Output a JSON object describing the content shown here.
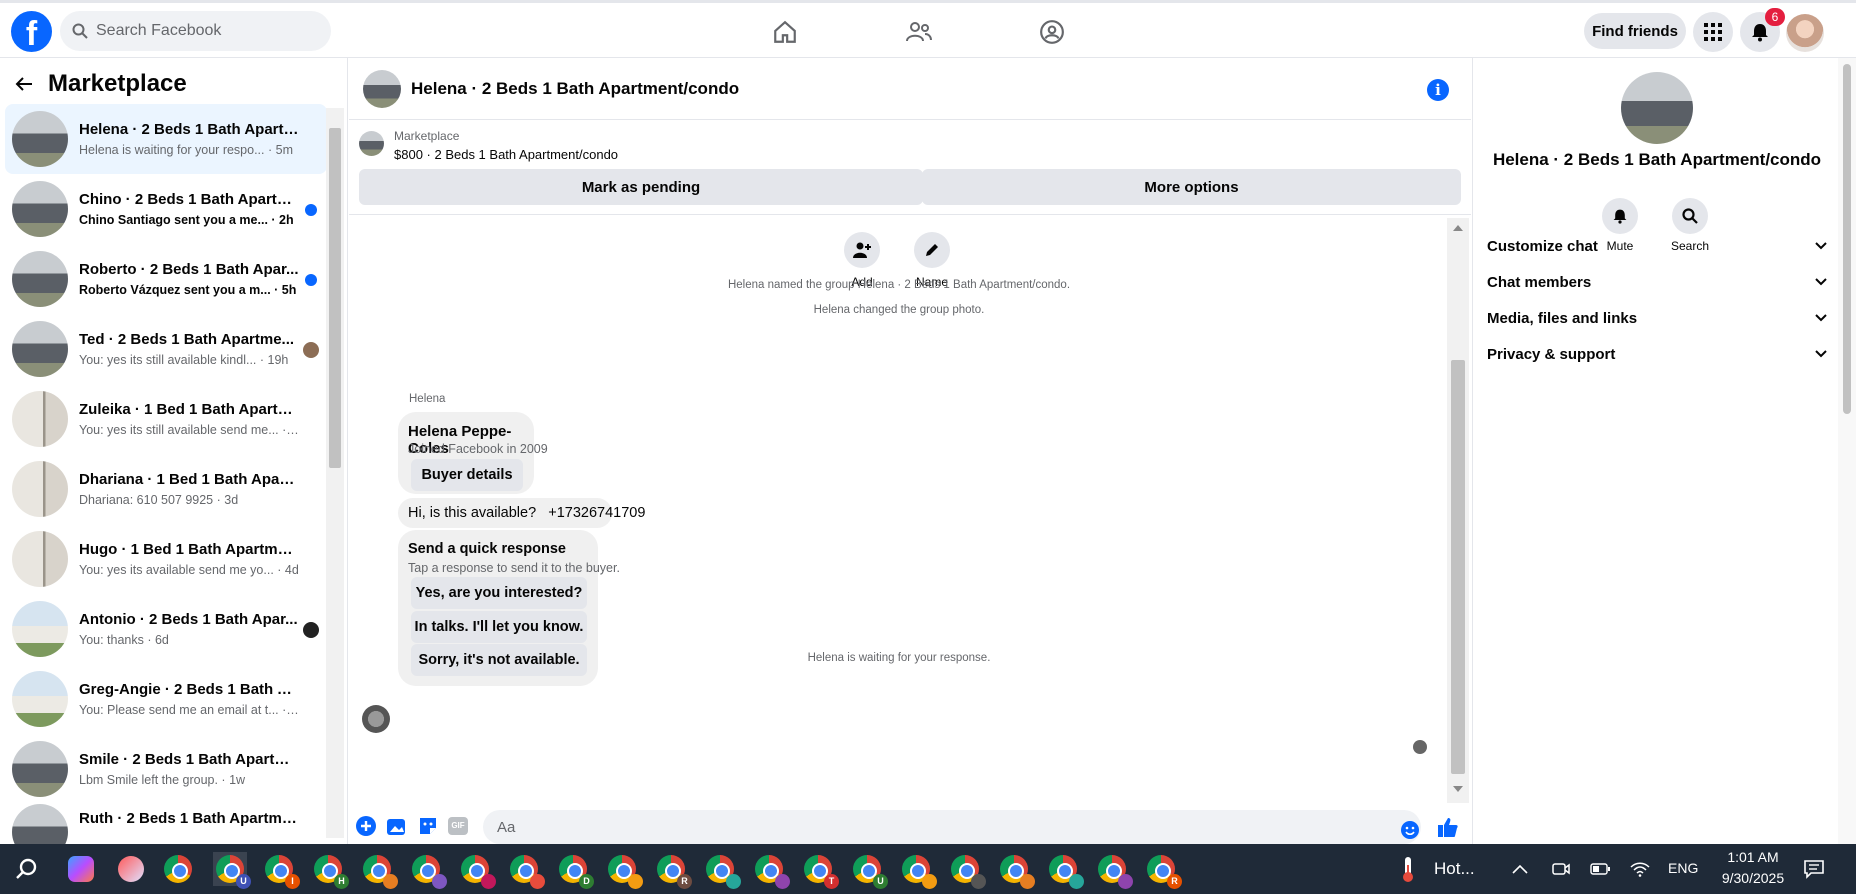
{
  "topbar": {
    "logo": "f",
    "search_placeholder": "Search Facebook",
    "find_friends": "Find friends",
    "notif_count": "6"
  },
  "sidebar": {
    "title": "Marketplace",
    "conversations": [
      {
        "name": "Helena · 2 Beds 1 Bath Apartm...",
        "sub": "Helena is waiting for your respo... · 5m",
        "active": true
      },
      {
        "name": "Chino · 2 Beds 1 Bath Apartm...",
        "sub": "Chino Santiago sent you a me... · 2h",
        "unread": true
      },
      {
        "name": "Roberto · 2 Beds 1 Bath Apar...",
        "sub": "Roberto Vázquez sent you a m... · 5h",
        "unread": true
      },
      {
        "name": "Ted · 2 Beds 1 Bath Apartme...",
        "sub": "You: yes its still available kindl... · 19h"
      },
      {
        "name": "Zuleika · 1 Bed 1 Bath Apartme...",
        "sub": "You: yes its still available send me... · 2d"
      },
      {
        "name": "Dhariana · 1 Bed 1 Bath Apartm...",
        "sub": "Dhariana: 610 507 9925 · 3d"
      },
      {
        "name": "Hugo · 1 Bed 1 Bath Apartment...",
        "sub": "You: yes its available send me yo... · 4d"
      },
      {
        "name": "Antonio · 2 Beds 1 Bath Apar...",
        "sub": "You: thanks · 6d"
      },
      {
        "name": "Greg-Angie · 2 Beds 1 Bath Ap...",
        "sub": "You: Please send me an email at t... · 6d"
      },
      {
        "name": "Smile · 2 Beds 1 Bath Apartme...",
        "sub": "Lbm Smile left the group. · 1w"
      },
      {
        "name": "Ruth · 2 Beds 1 Bath Apartmen...",
        "sub": ""
      }
    ]
  },
  "chat": {
    "title": "Helena · 2 Beds 1 Bath Apartment/condo",
    "listing_source": "Marketplace",
    "listing_price": "$800 · 2 Beds 1 Bath Apartment/condo",
    "mark_pending": "Mark as pending",
    "more_options": "More options",
    "add_label": "Add",
    "name_label": "Name",
    "sys1": "Helena named the group Helena · 2 Beds 1 Bath Apartment/condo.",
    "sys2": "Helena changed the group photo.",
    "sender": "Helena",
    "buyer_name": "Helena Peppe-Coles",
    "buyer_joined": "Joined Facebook in 2009",
    "buyer_details": "Buyer details",
    "message": "Hi, is this available?   +17326741709",
    "quick_title": "Send a quick response",
    "quick_sub": "Tap a response to send it to the buyer.",
    "quick1": "Yes, are you interested?",
    "quick2": "In talks. I'll let you know.",
    "quick3": "Sorry, it's not available.",
    "waiting": "Helena is waiting for your response.",
    "composer_placeholder": "Aa",
    "gif": "GIF"
  },
  "details": {
    "title": "Helena · 2 Beds 1 Bath Apartment/condo",
    "mute": "Mute",
    "search": "Search",
    "sections": [
      "Customize chat",
      "Chat members",
      "Media, files and links",
      "Privacy & support"
    ]
  },
  "taskbar": {
    "weather": "Hot...",
    "lang": "ENG",
    "time": "1:01 AM",
    "date": "9/30/2025",
    "chrome_letters": [
      "U",
      "I",
      "H",
      "",
      "",
      "",
      "",
      "D",
      "",
      "R",
      "",
      "",
      "T",
      "U",
      "",
      "",
      "",
      "",
      "",
      "R"
    ]
  },
  "colors": {
    "brand": "#0866ff",
    "badge": "#e41e3f",
    "unread_dot": "#0866ff"
  }
}
